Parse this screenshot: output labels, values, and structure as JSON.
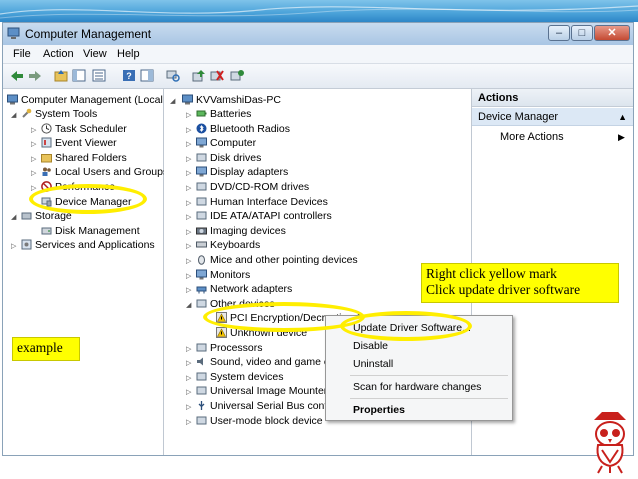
{
  "window": {
    "title": "Computer Management",
    "controls": [
      "–",
      "□",
      "✕"
    ]
  },
  "menu": [
    "File",
    "Action",
    "View",
    "Help"
  ],
  "left_tree": {
    "root": "Computer Management (Local",
    "items": [
      {
        "label": "System Tools",
        "icon": "tools-icon"
      },
      {
        "label": "Task Scheduler",
        "icon": "clock-icon"
      },
      {
        "label": "Event Viewer",
        "icon": "event-viewer-icon"
      },
      {
        "label": "Shared Folders",
        "icon": "folder-icon"
      },
      {
        "label": "Local Users and Groups",
        "icon": "users-icon"
      },
      {
        "label": "Performance",
        "icon": "performance-icon"
      },
      {
        "label": "Device Manager",
        "icon": "device-manager-icon"
      },
      {
        "label": "Storage",
        "icon": "storage-icon"
      },
      {
        "label": "Disk Management",
        "icon": "disk-icon"
      },
      {
        "label": "Services and Applications",
        "icon": "services-icon"
      }
    ]
  },
  "device_tree": {
    "root": "KVVamshiDas-PC",
    "items": [
      {
        "label": "Batteries",
        "icon": "battery-icon"
      },
      {
        "label": "Bluetooth Radios",
        "icon": "bluetooth-icon"
      },
      {
        "label": "Computer",
        "icon": "computer-icon"
      },
      {
        "label": "Disk drives",
        "icon": "disk-icon"
      },
      {
        "label": "Display adapters",
        "icon": "display-icon"
      },
      {
        "label": "DVD/CD-ROM drives",
        "icon": "dvd-icon"
      },
      {
        "label": "Human Interface Devices",
        "icon": "hid-icon"
      },
      {
        "label": "IDE ATA/ATAPI controllers",
        "icon": "ide-icon"
      },
      {
        "label": "Imaging devices",
        "icon": "camera-icon"
      },
      {
        "label": "Keyboards",
        "icon": "keyboard-icon"
      },
      {
        "label": "Mice and other pointing devices",
        "icon": "mouse-icon"
      },
      {
        "label": "Monitors",
        "icon": "monitor-icon"
      },
      {
        "label": "Network adapters",
        "icon": "network-icon"
      },
      {
        "label": "Other devices",
        "icon": "other-devices-icon"
      },
      {
        "label": "PCI Encryption/Decryption Controll",
        "icon": "warning-icon"
      },
      {
        "label": "Unknown device",
        "icon": "warning-icon"
      },
      {
        "label": "Processors",
        "icon": "processor-icon"
      },
      {
        "label": "Sound, video and game c",
        "icon": "sound-icon"
      },
      {
        "label": "System devices",
        "icon": "system-icon"
      },
      {
        "label": "Universal Image Mounter",
        "icon": "image-mounter-icon"
      },
      {
        "label": "Universal Serial Bus contro",
        "icon": "usb-icon"
      },
      {
        "label": "User-mode block device",
        "icon": "block-device-icon"
      }
    ]
  },
  "actions": {
    "header": "Actions",
    "section": "Device Manager",
    "more": "More Actions"
  },
  "context_menu": {
    "items": [
      "Update Driver Software...",
      "Disable",
      "Uninstall",
      "Scan for hardware changes",
      "Properties"
    ]
  },
  "notes": {
    "example": "example",
    "instruction_line1": "Right click yellow mark",
    "instruction_line2": "Click update driver software"
  },
  "colors": {
    "highlight": "#ffff00",
    "selection": "#dce8f5",
    "slide_accent": "#4aa2d9"
  }
}
